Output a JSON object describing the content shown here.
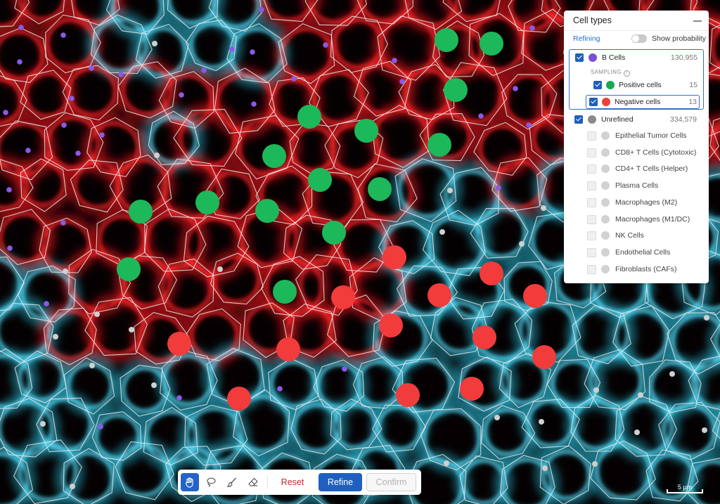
{
  "panel": {
    "title": "Cell types",
    "refining_label": "Refining",
    "show_probability_label": "Show probability",
    "show_probability_on": false,
    "b_cells": {
      "label": "B Cells",
      "count": "130,955",
      "color": "#7e4fd6",
      "checked": true
    },
    "sampling_label": "SAMPLING",
    "positive": {
      "label": "Positive cells",
      "count": "15",
      "color": "#18a84f",
      "checked": true
    },
    "negative": {
      "label": "Negative cells",
      "count": "13",
      "color": "#ef3e3e",
      "checked": true
    },
    "unrefined": {
      "label": "Unrefined",
      "count": "334,579",
      "color": "#8a8a8a",
      "checked": true
    },
    "subtypes": [
      {
        "label": "Epithelial Tumor Cells"
      },
      {
        "label": "CD8+ T Cells (Cytotoxic)"
      },
      {
        "label": "CD4+ T Cells (Helper)"
      },
      {
        "label": "Plasma Cells"
      },
      {
        "label": "Macrophages (M2)"
      },
      {
        "label": "Macrophages (M1/DC)"
      },
      {
        "label": "NK Cells"
      },
      {
        "label": "Endothelial Cells"
      },
      {
        "label": "Fibroblasts (CAFs)"
      }
    ]
  },
  "toolbar": {
    "active_tool": "pan",
    "tools": [
      "hand-icon",
      "lasso-icon",
      "brush-icon",
      "eraser-icon"
    ],
    "reset_label": "Reset",
    "refine_label": "Refine",
    "confirm_label": "Confirm"
  },
  "scalebar": {
    "label": "5 µm"
  },
  "colors": {
    "positive_marker": "#1cb85a",
    "negative_marker": "#f23b3b",
    "b_cell_marker": "#8a5ae6",
    "unrefined_marker": "#cfcfcf",
    "membrane_red": "#e8141b",
    "membrane_cyan": "#27c6e6",
    "accent": "#1f5fbf"
  }
}
